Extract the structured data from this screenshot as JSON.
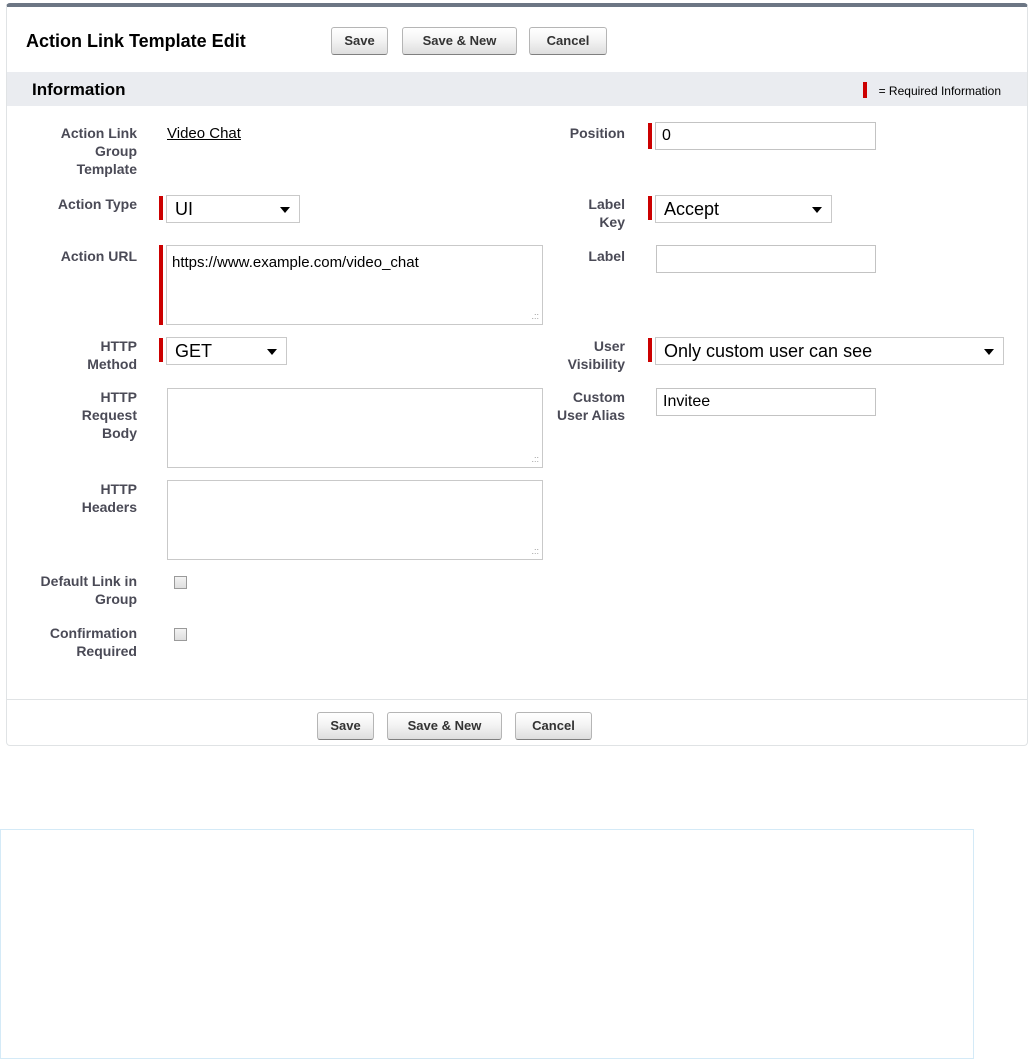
{
  "header": {
    "title": "Action Link Template Edit",
    "save_label": "Save",
    "save_new_label": "Save & New",
    "cancel_label": "Cancel"
  },
  "section": {
    "title": "Information",
    "required_legend": "= Required Information"
  },
  "fields": {
    "group_template": {
      "label": "Action Link Group Template",
      "value": "Video Chat"
    },
    "action_type": {
      "label": "Action Type",
      "value": "UI"
    },
    "action_url": {
      "label": "Action URL",
      "value": "https://www.example.com/video_chat"
    },
    "http_method": {
      "label": "HTTP Method",
      "value": "GET"
    },
    "http_request_body": {
      "label": "HTTP Request Body",
      "value": ""
    },
    "http_headers": {
      "label": "HTTP Headers",
      "value": ""
    },
    "default_link": {
      "label": "Default Link in Group",
      "checked": false
    },
    "confirmation_required": {
      "label": "Confirmation Required",
      "checked": false
    },
    "position": {
      "label": "Position",
      "value": "0"
    },
    "label_key": {
      "label": "Label Key",
      "value": "Accept"
    },
    "label": {
      "label": "Label",
      "value": ""
    },
    "user_visibility": {
      "label": "User Visibility",
      "value": "Only custom user can see"
    },
    "custom_user_alias": {
      "label": "Custom User Alias",
      "value": "Invitee"
    }
  },
  "footer": {
    "save_label": "Save",
    "save_new_label": "Save & New",
    "cancel_label": "Cancel"
  },
  "colors": {
    "required_marker": "#cc0000",
    "section_bar": "#eaecf0",
    "panel_top_border": "#6c7684",
    "label_text": "#4a4a56"
  }
}
